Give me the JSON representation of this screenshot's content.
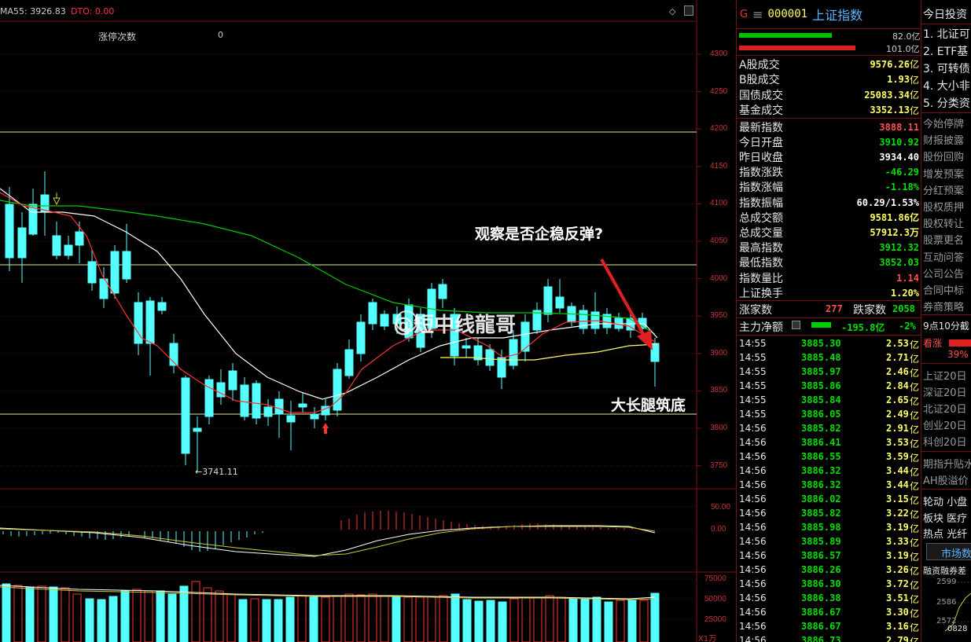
{
  "chart": {
    "ma_label": "MA55: 3926.83",
    "dto_label": "DTO: 0.00",
    "limit_label": "涨停次数",
    "limit_value": "0",
    "low_marker": "←3741.11",
    "annotation_top": "观察是否企稳反弹?",
    "annotation_bottom": "大长腿筑底",
    "watermark": "@短中线龍哥",
    "price_ticks": [
      "4300",
      "4250",
      "4200",
      "4150",
      "4100",
      "4050",
      "4000",
      "3950",
      "3900",
      "3850",
      "3800",
      "3750"
    ],
    "macd_ticks": [
      "50.00",
      "0.00"
    ],
    "vol_ticks": [
      "75000",
      "50000",
      "25000"
    ],
    "vol_unit": "X1万",
    "colors": {
      "up": "#ff3232",
      "down": "#54ffff",
      "ma5": "#ff3232",
      "ma10": "#ffffff",
      "ma20": "#ffff66",
      "ma60": "#00cc00"
    }
  },
  "panel": {
    "code_prefix": "G",
    "menu_icon": "≡",
    "code": "000001",
    "name": "上证指数",
    "bar1_value": "82.0亿",
    "bar2_value": "101.0亿",
    "turnover": [
      {
        "label": "A股成交",
        "value": "9576.26",
        "unit": "亿"
      },
      {
        "label": "B股成交",
        "value": "1.93",
        "unit": "亿"
      },
      {
        "label": "国债成交",
        "value": "25083.34",
        "unit": "亿"
      },
      {
        "label": "基金成交",
        "value": "3352.13",
        "unit": "亿"
      }
    ],
    "stats": [
      {
        "label": "最新指数",
        "value": "3888.11",
        "color": "#ff5050"
      },
      {
        "label": "今日开盘",
        "value": "3910.92",
        "color": "#00e000"
      },
      {
        "label": "昨日收盘",
        "value": "3934.40",
        "color": "#ffffff"
      },
      {
        "label": "指数涨跌",
        "value": "-46.29",
        "color": "#00e000"
      },
      {
        "label": "指数涨幅",
        "value": "-1.18%",
        "color": "#00e000"
      },
      {
        "label": "指数振幅",
        "value": "60.29/1.53%",
        "color": "#ffffff"
      },
      {
        "label": "总成交额",
        "value": "9581.86亿",
        "color": "#ffff66"
      },
      {
        "label": "总成交量",
        "value": "57912.3万",
        "color": "#ffff66"
      },
      {
        "label": "最高指数",
        "value": "3912.32",
        "color": "#00e000"
      },
      {
        "label": "最低指数",
        "value": "3852.03",
        "color": "#00e000"
      },
      {
        "label": "指数量比",
        "value": "1.14",
        "color": "#ff5050"
      },
      {
        "label": "上证换手",
        "value": "1.20%",
        "color": "#ffff66"
      }
    ],
    "up_label": "涨家数",
    "up_count": "277",
    "down_label": "跌家数",
    "down_count": "2058",
    "net_label": "主力净额",
    "net_value": "-195.8亿",
    "net_pct": "-2%",
    "ticks": [
      {
        "time": "14:55",
        "price": "3885.30",
        "amount": "2.53",
        "unit": "亿"
      },
      {
        "time": "14:55",
        "price": "3885.48",
        "amount": "2.71",
        "unit": "亿"
      },
      {
        "time": "14:55",
        "price": "3885.97",
        "amount": "2.46",
        "unit": "亿"
      },
      {
        "time": "14:55",
        "price": "3885.86",
        "amount": "2.84",
        "unit": "亿"
      },
      {
        "time": "14:55",
        "price": "3885.84",
        "amount": "2.65",
        "unit": "亿"
      },
      {
        "time": "14:55",
        "price": "3886.05",
        "amount": "2.49",
        "unit": "亿"
      },
      {
        "time": "14:56",
        "price": "3885.82",
        "amount": "2.91",
        "unit": "亿"
      },
      {
        "time": "14:56",
        "price": "3886.41",
        "amount": "3.53",
        "unit": "亿"
      },
      {
        "time": "14:56",
        "price": "3886.55",
        "amount": "3.59",
        "unit": "亿"
      },
      {
        "time": "14:56",
        "price": "3886.32",
        "amount": "3.44",
        "unit": "亿"
      },
      {
        "time": "14:56",
        "price": "3886.32",
        "amount": "3.44",
        "unit": "亿"
      },
      {
        "time": "14:56",
        "price": "3886.02",
        "amount": "3.15",
        "unit": "亿"
      },
      {
        "time": "14:56",
        "price": "3885.82",
        "amount": "3.22",
        "unit": "亿"
      },
      {
        "time": "14:56",
        "price": "3885.98",
        "amount": "3.19",
        "unit": "亿"
      },
      {
        "time": "14:56",
        "price": "3885.89",
        "amount": "3.33",
        "unit": "亿"
      },
      {
        "time": "14:56",
        "price": "3886.57",
        "amount": "3.19",
        "unit": "亿"
      },
      {
        "time": "14:56",
        "price": "3886.26",
        "amount": "3.26",
        "unit": "亿"
      },
      {
        "time": "14:56",
        "price": "3886.30",
        "amount": "3.72",
        "unit": "亿"
      },
      {
        "time": "14:56",
        "price": "3886.38",
        "amount": "3.51",
        "unit": "亿"
      },
      {
        "time": "14:56",
        "price": "3886.67",
        "amount": "3.30",
        "unit": "亿"
      },
      {
        "time": "14:56",
        "price": "3886.67",
        "amount": "3.16",
        "unit": "亿"
      },
      {
        "time": "14:56",
        "price": "3886.73",
        "amount": "2.79",
        "unit": "亿"
      }
    ]
  },
  "far": {
    "title": "今日投资",
    "items": [
      "1. 北证可",
      "2. ETF基",
      "3. 可转债",
      "4. 大小非",
      "5. 分类资"
    ],
    "links": [
      "今始停牌",
      "财报披露",
      "股份回购",
      "增发预案",
      "分红预案",
      "股权质押",
      "股权转让",
      "股票更名",
      "互动问答",
      "公司公告",
      "合同中标",
      "券商策略"
    ],
    "time_label": "9点10分截",
    "rise_label": "看涨",
    "rise_pct": "39%",
    "flows": [
      "上证20日",
      "深证20日",
      "北证20日",
      "创业20日",
      "科创20日"
    ],
    "misc": [
      "期指升贴水",
      "AH股溢价"
    ],
    "rotation": [
      "轮动 小盘",
      "板块 医疗",
      "热点 光纤"
    ],
    "market_btn": "市场数",
    "margin_label": "融资融券差",
    "mini_ticks": [
      "2599",
      "2586",
      "2572"
    ],
    "mini_time": "0828"
  }
}
